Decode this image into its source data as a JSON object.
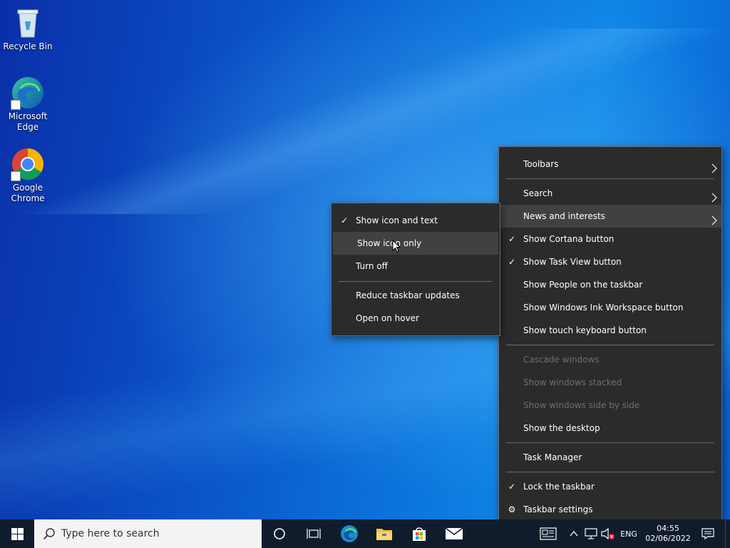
{
  "desktop": {
    "icons": [
      {
        "label_line1": "Recycle Bin",
        "label_line2": ""
      },
      {
        "label_line1": "Microsoft",
        "label_line2": "Edge"
      },
      {
        "label_line1": "Google",
        "label_line2": "Chrome"
      }
    ]
  },
  "context_menu": {
    "items": [
      {
        "label": "Toolbars",
        "checked": false,
        "submenu": true,
        "disabled": false
      },
      {
        "label": "Search",
        "checked": false,
        "submenu": true,
        "disabled": false
      },
      {
        "label": "News and interests",
        "checked": false,
        "submenu": true,
        "disabled": false,
        "highlighted": true
      },
      {
        "label": "Show Cortana button",
        "checked": true,
        "submenu": false,
        "disabled": false
      },
      {
        "label": "Show Task View button",
        "checked": true,
        "submenu": false,
        "disabled": false
      },
      {
        "label": "Show People on the taskbar",
        "checked": false,
        "submenu": false,
        "disabled": false
      },
      {
        "label": "Show Windows Ink Workspace button",
        "checked": false,
        "submenu": false,
        "disabled": false
      },
      {
        "label": "Show touch keyboard button",
        "checked": false,
        "submenu": false,
        "disabled": false
      },
      {
        "label": "Cascade windows",
        "checked": false,
        "submenu": false,
        "disabled": true
      },
      {
        "label": "Show windows stacked",
        "checked": false,
        "submenu": false,
        "disabled": true
      },
      {
        "label": "Show windows side by side",
        "checked": false,
        "submenu": false,
        "disabled": true
      },
      {
        "label": "Show the desktop",
        "checked": false,
        "submenu": false,
        "disabled": false
      },
      {
        "label": "Task Manager",
        "checked": false,
        "submenu": false,
        "disabled": false
      },
      {
        "label": "Lock the taskbar",
        "checked": true,
        "submenu": false,
        "disabled": false
      },
      {
        "label": "Taskbar settings",
        "checked": false,
        "submenu": false,
        "disabled": false,
        "icon": "gear-icon"
      }
    ]
  },
  "submenu": {
    "items": [
      {
        "label": "Show icon and text",
        "checked": true
      },
      {
        "label": "Show icon only",
        "checked": false,
        "highlighted": true
      },
      {
        "label": "Turn off",
        "checked": false
      },
      {
        "label": "Reduce taskbar updates",
        "checked": false
      },
      {
        "label": "Open on hover",
        "checked": false
      }
    ]
  },
  "taskbar": {
    "search_placeholder": "Type here to search",
    "pinned": [
      "cortana-icon",
      "task-view-icon",
      "edge-icon",
      "file-explorer-icon",
      "store-icon",
      "mail-icon"
    ],
    "tray": {
      "language": "ENG",
      "time": "04:55",
      "date": "02/06/2022"
    }
  },
  "colors": {
    "menu_bg": "#2b2b2b",
    "menu_highlight": "#414141",
    "taskbar_bg": "#101c2c"
  }
}
